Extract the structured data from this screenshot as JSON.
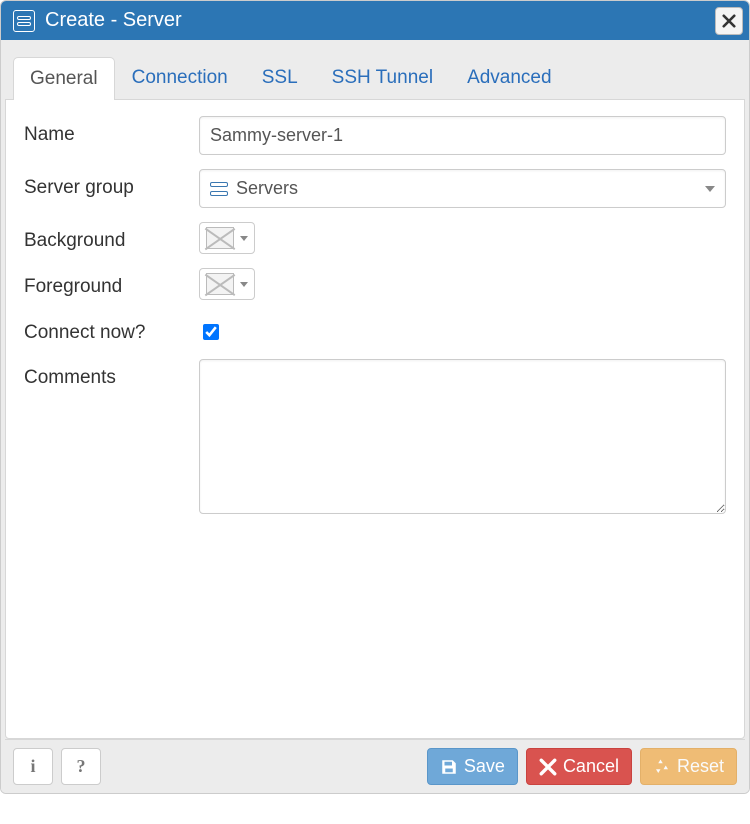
{
  "dialog": {
    "title": "Create - Server"
  },
  "tabs": {
    "general": "General",
    "connection": "Connection",
    "ssl": "SSL",
    "ssh_tunnel": "SSH Tunnel",
    "advanced": "Advanced"
  },
  "labels": {
    "name": "Name",
    "server_group": "Server group",
    "background": "Background",
    "foreground": "Foreground",
    "connect_now": "Connect now?",
    "comments": "Comments"
  },
  "values": {
    "name": "Sammy-server-1",
    "server_group": "Servers",
    "connect_now": true,
    "comments": ""
  },
  "footer": {
    "info": "i",
    "help": "?",
    "save": "Save",
    "cancel": "Cancel",
    "reset": "Reset"
  }
}
